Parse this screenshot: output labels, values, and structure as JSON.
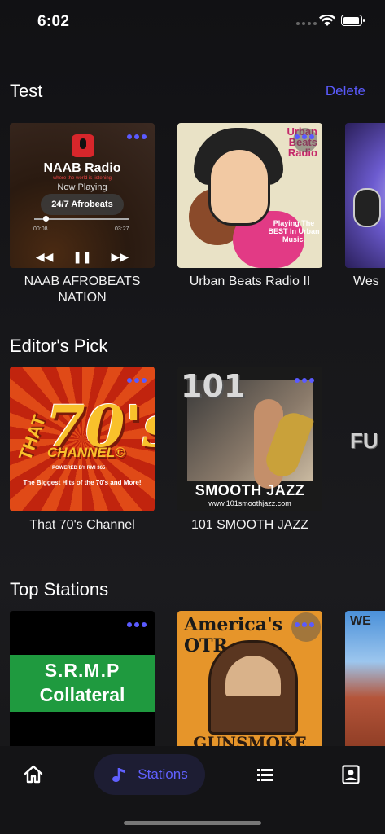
{
  "status_bar": {
    "time": "6:02"
  },
  "sections": {
    "test": {
      "title": "Test",
      "action": "Delete",
      "cards": [
        {
          "label": "NAAB AFROBEATS NATION",
          "art": {
            "brand": "NAAB Radio",
            "tagline": "where the world is listening",
            "now_playing": "Now Playing",
            "track": "24/7 Afrobeats",
            "elapsed": "00:08",
            "duration": "03:27",
            "progress": 0.12
          }
        },
        {
          "label": "Urban Beats Radio II",
          "art": {
            "title": "Urban Beats Radio",
            "promo": "Playing The BEST In Urban Music."
          }
        },
        {
          "label": "Wes"
        }
      ]
    },
    "editors_pick": {
      "title": "Editor's Pick",
      "cards": [
        {
          "label": "That 70's Channel",
          "art": {
            "that": "THAT",
            "big": "70's",
            "channel": "CHANNEL©",
            "powered": "POWERED BY RMI 365",
            "tagline": "The Biggest Hits of the 70's and More!"
          }
        },
        {
          "label": "101 SMOOTH JAZZ",
          "art": {
            "number": "101",
            "name": "SMOOTH JAZZ",
            "url": "www.101smoothjazz.com"
          }
        }
      ],
      "partial_logo": "FU"
    },
    "top_stations": {
      "title": "Top Stations",
      "cards": [
        {
          "art": {
            "line1": "S.R.M.P",
            "line2": "Collateral"
          }
        },
        {
          "art": {
            "head": "America's OTR",
            "bottom": "GUNSMOKE"
          }
        },
        {
          "art": {
            "head": "WE"
          }
        }
      ]
    }
  },
  "tab_bar": {
    "active": "stations",
    "stations_label": "Stations",
    "icons": [
      "home-icon",
      "music-note-icon",
      "list-icon",
      "profile-icon"
    ],
    "accent": "#5b5bff"
  },
  "colors": {
    "accent": "#5b5bff",
    "background": "#17171a"
  }
}
